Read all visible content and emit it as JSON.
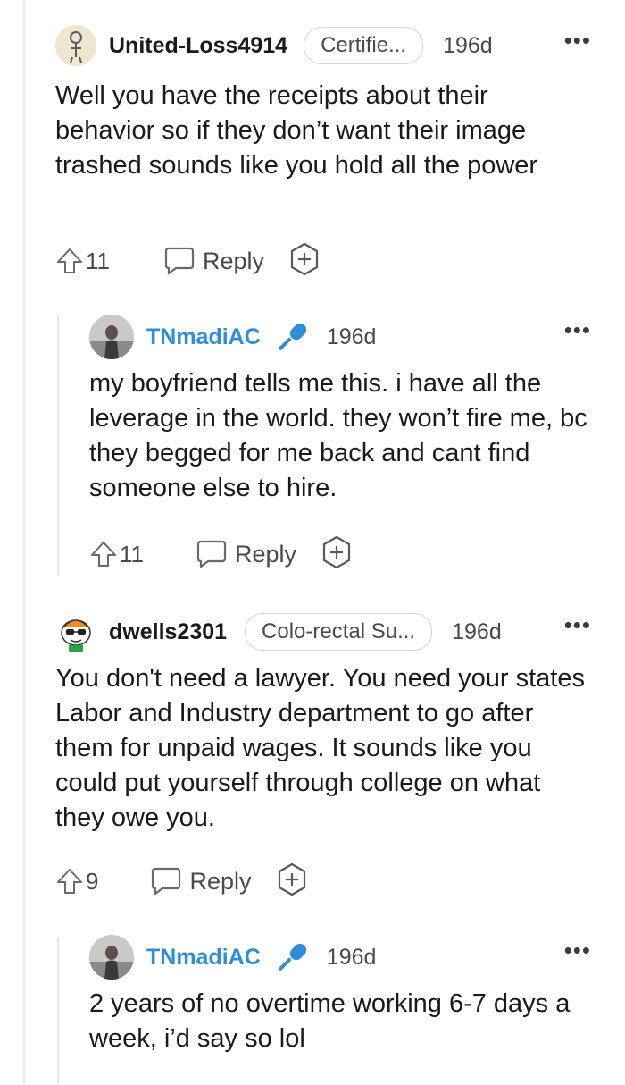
{
  "comments": [
    {
      "username": "United-Loss4914",
      "flair": "Certifie...",
      "age": "196d",
      "more": "•••",
      "body": "Well you have the receipts about their behavior so if they don’t want their image trashed sounds like you hold all the power",
      "votes": "11",
      "reply_label": "Reply"
    },
    {
      "username": "TNmadiAC",
      "age": "196d",
      "more": "•••",
      "body": "my boyfriend tells me this. i have all the leverage in the world. they won’t fire me, bc they begged for me back and cant find someone else to hire.",
      "votes": "11",
      "reply_label": "Reply"
    },
    {
      "username": "dwells2301",
      "flair": "Colo-rectal Su...",
      "age": "196d",
      "more": "•••",
      "body": "You don't need a lawyer. You need your states Labor and Industry department to go after them for unpaid wages. It sounds like you could put yourself through college on what they owe you.",
      "votes": "9",
      "reply_label": "Reply"
    },
    {
      "username": "TNmadiAC",
      "age": "196d",
      "more": "•••",
      "body": "2 years of no overtime working 6-7 days a week, i’d say so lol"
    }
  ],
  "colors": {
    "op_username": "#2f8fd6",
    "text": "#1a1a1b",
    "muted": "#4a4a4a"
  },
  "icons": [
    "upvote-icon",
    "reply-bubble-icon",
    "award-plus-icon",
    "microphone-icon",
    "more-icon"
  ]
}
